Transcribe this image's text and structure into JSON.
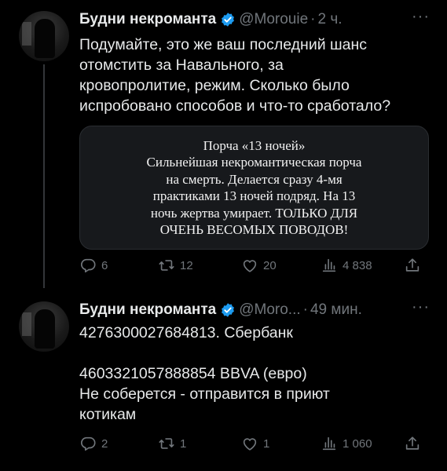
{
  "tweets": [
    {
      "name": "Будни некроманта",
      "handle": "@Morouie",
      "dot": "·",
      "time": "2 ч.",
      "text": [
        "Подумайте, это же ваш последний шанс",
        "отомстить за Навального, за",
        "кровопролитие, режим. Сколько было",
        "испробовано способов и что-то сработало?"
      ],
      "quote_lines": [
        "Порча «13 ночей»",
        "Сильнейшая некромантическая порча",
        "на смерть. Делается сразу 4-мя",
        "практиками 13 ночей подряд. На 13",
        "ночь жертва умирает. ТОЛЬКО ДЛЯ",
        "ОЧЕНЬ ВЕСОМЫХ ПОВОДОВ!"
      ],
      "replies": "6",
      "retweets": "12",
      "likes": "20",
      "views": "4 838"
    },
    {
      "name": "Будни некроманта",
      "handle": "@Moro...",
      "dot": "·",
      "time": "49 мин.",
      "text": [
        "4276300027684813. Сбербанк",
        "",
        "4603321057888854 BBVA (евро)",
        "Не соберется - отправится в приют",
        "котикам"
      ],
      "replies": "2",
      "retweets": "1",
      "likes": "1",
      "views": "1 060"
    }
  ],
  "more_label": "···",
  "icons": {
    "verified": "verified-badge-icon",
    "reply": "reply-icon",
    "retweet": "retweet-icon",
    "like": "heart-icon",
    "views": "views-icon",
    "share": "share-icon"
  },
  "colors": {
    "background": "#000000",
    "text": "#e7e9ea",
    "muted": "#71767b",
    "verified": "#1d9bf0"
  }
}
